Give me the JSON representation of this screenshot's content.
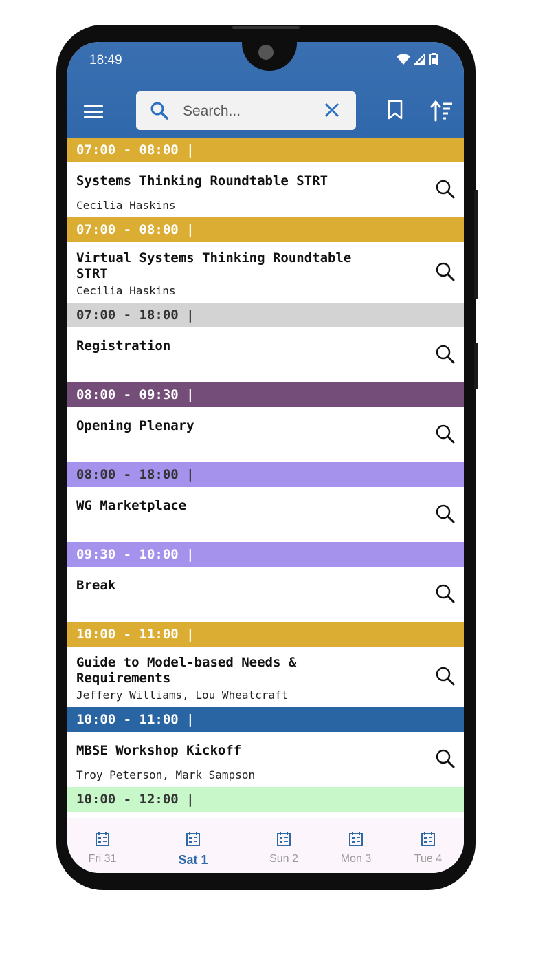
{
  "status_bar": {
    "time": "18:49"
  },
  "search": {
    "placeholder": "Search..."
  },
  "icons": {
    "menu": "menu-icon",
    "search": "search-icon",
    "clear": "close-icon",
    "bookmark": "bookmark-icon",
    "sort": "sort-icon",
    "item_search": "magnifier-icon",
    "calendar": "calendar-icon"
  },
  "colors": {
    "appbar": "#2f68ab",
    "gold": "#dbad32",
    "gray": "#d3d3d3",
    "purple": "#754d79",
    "lavender": "#a592ec",
    "blue": "#2a65a3",
    "green": "#c8f7c9",
    "active_tab": "#2e6aa8"
  },
  "sessions": [
    {
      "time": "07:00 - 08:00 |",
      "title": "Systems Thinking Roundtable STRT",
      "speakers": "Cecilia Haskins",
      "color": "#dbad32",
      "text_color": "#ffffff"
    },
    {
      "time": "07:00 - 08:00 |",
      "title": "Virtual Systems Thinking Roundtable STRT",
      "speakers": "Cecilia Haskins",
      "color": "#dbad32",
      "text_color": "#ffffff"
    },
    {
      "time": "07:00 - 18:00 |",
      "title": "Registration",
      "speakers": "",
      "color": "#d3d3d3",
      "text_color": "#333333"
    },
    {
      "time": "08:00 - 09:30 |",
      "title": "Opening Plenary",
      "speakers": "",
      "color": "#754d79",
      "text_color": "#ffffff"
    },
    {
      "time": "08:00 - 18:00 |",
      "title": "WG Marketplace",
      "speakers": "",
      "color": "#a592ec",
      "text_color": "#333333"
    },
    {
      "time": "09:30 - 10:00 |",
      "title": "Break",
      "speakers": "",
      "color": "#a592ec",
      "text_color": "#ffffff"
    },
    {
      "time": "10:00 - 11:00 |",
      "title": "Guide to Model-based Needs & Requirements",
      "speakers": "Jeffery Williams, Lou Wheatcraft",
      "color": "#dbad32",
      "text_color": "#ffffff"
    },
    {
      "time": "10:00 - 11:00 |",
      "title": "MBSE Workshop Kickoff",
      "speakers": "Troy Peterson, Mark Sampson",
      "color": "#2a65a3",
      "text_color": "#ffffff"
    },
    {
      "time": "10:00 - 12:00 |",
      "title": "",
      "speakers": "",
      "color": "#c8f7c9",
      "text_color": "#333333"
    }
  ],
  "tabs": [
    {
      "label": "Fri 31",
      "active": false
    },
    {
      "label": "Sat 1",
      "active": true
    },
    {
      "label": "Sun 2",
      "active": false
    },
    {
      "label": "Mon 3",
      "active": false
    },
    {
      "label": "Tue 4",
      "active": false
    }
  ]
}
